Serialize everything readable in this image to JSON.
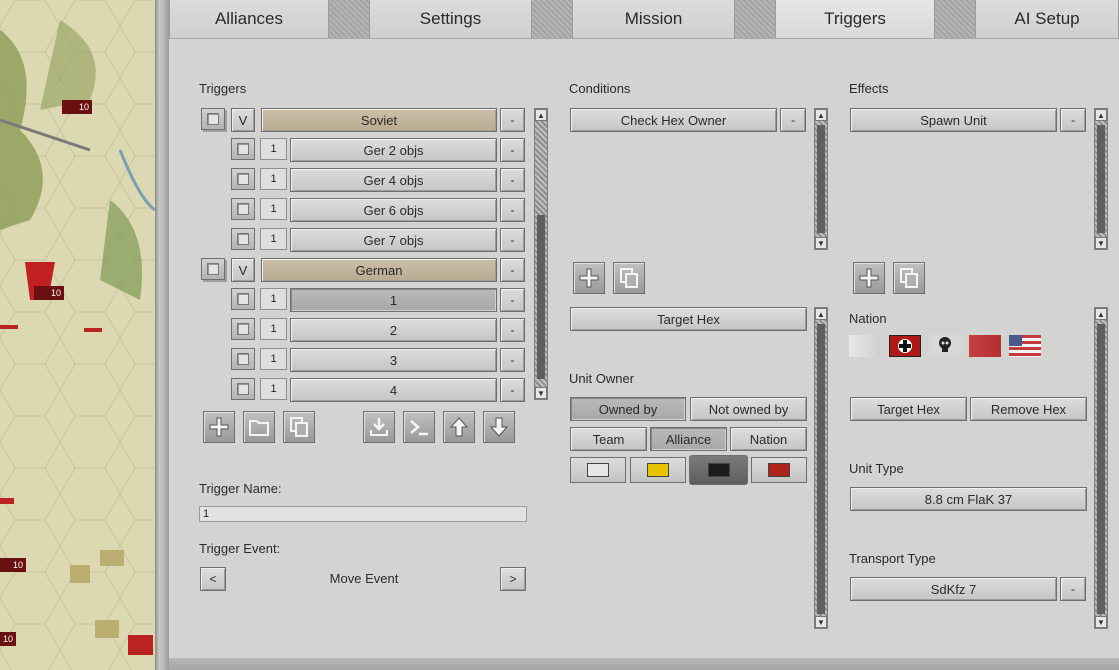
{
  "tabs": [
    {
      "label": "Alliances"
    },
    {
      "label": "Settings"
    },
    {
      "label": "Mission"
    },
    {
      "label": "Triggers",
      "active": true
    },
    {
      "label": "AI Setup"
    }
  ],
  "map": {
    "unit_counts": [
      "10",
      "10",
      "10",
      "10"
    ]
  },
  "triggers": {
    "title": "Triggers",
    "groups": [
      {
        "flag": "V",
        "name": "Soviet",
        "items": [
          {
            "count": "1",
            "name": "Ger 2 objs"
          },
          {
            "count": "1",
            "name": "Ger 4 objs"
          },
          {
            "count": "1",
            "name": "Ger 6 objs"
          },
          {
            "count": "1",
            "name": "Ger 7 objs"
          }
        ]
      },
      {
        "flag": "V",
        "name": "German",
        "items": [
          {
            "count": "1",
            "name": "1"
          },
          {
            "count": "1",
            "name": "2"
          },
          {
            "count": "1",
            "name": "3"
          },
          {
            "count": "1",
            "name": "4"
          }
        ]
      }
    ],
    "remove_label": "-",
    "trigger_name_label": "Trigger Name:",
    "trigger_name_value": "1",
    "trigger_event_label": "Trigger Event:",
    "trigger_event_value": "Move Event",
    "prev_label": "<",
    "next_label": ">"
  },
  "conditions": {
    "title": "Conditions",
    "items": [
      "Check Hex Owner"
    ],
    "remove_label": "-",
    "target_hex": "Target Hex",
    "unit_owner_label": "Unit Owner",
    "owned_by": "Owned by",
    "not_owned_by": "Not owned by",
    "team": "Team",
    "alliance": "Alliance",
    "nation": "Nation",
    "swatches": [
      "#e6e6e4",
      "#e8c400",
      "#1b1b1b",
      "#b0221c"
    ]
  },
  "effects": {
    "title": "Effects",
    "items": [
      "Spawn Unit"
    ],
    "remove_label": "-",
    "nation_label": "Nation",
    "target_hex": "Target Hex",
    "remove_hex": "Remove Hex",
    "unit_type_label": "Unit Type",
    "unit_type_value": "8.8 cm FlaK 37",
    "transport_type_label": "Transport Type",
    "transport_type_value": "SdKfz 7"
  }
}
